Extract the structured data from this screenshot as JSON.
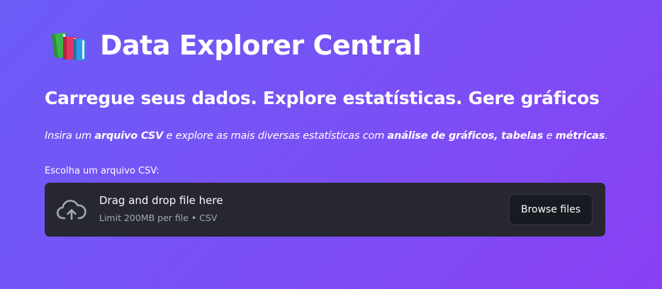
{
  "header": {
    "icon": "books-icon",
    "title": "Data Explorer Central"
  },
  "subtitle": "Carregue seus dados. Explore estatísticas. Gere gráficos",
  "description": {
    "part1": "Insira um ",
    "bold1": "arquivo CSV",
    "part2": " e explore as mais diversas estatísticas com ",
    "bold2": "análise de gráficos, tabelas",
    "part3": " e ",
    "bold3": "métricas",
    "part4": "."
  },
  "uploader": {
    "label": "Escolha um arquivo CSV:",
    "icon": "cloud-upload-icon",
    "drop_title": "Drag and drop file here",
    "limit_text": "Limit 200MB per file • CSV",
    "browse_label": "Browse files"
  },
  "colors": {
    "background_start": "#6b5cf6",
    "background_end": "#8a3ff4",
    "dropzone_bg": "#262730",
    "button_bg": "#181a22"
  }
}
